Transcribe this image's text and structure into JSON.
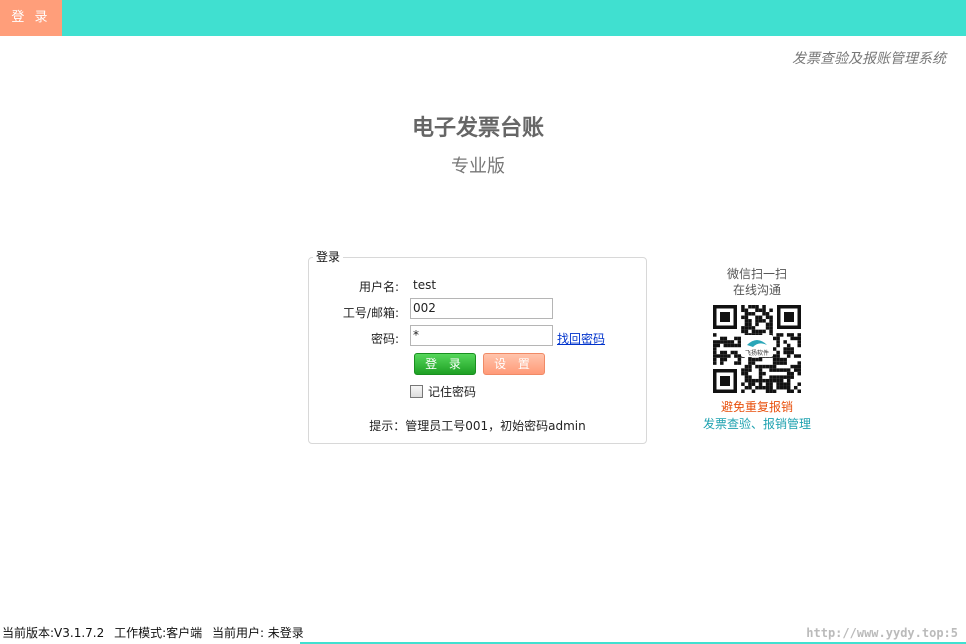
{
  "topbar": {
    "tab_label": "登 录",
    "bar_color": "#40e0d0",
    "tab_color": "#ff9e7a"
  },
  "header": {
    "system_name": "发票查验及报账管理系统",
    "app_title": "电子发票台账",
    "edition": "专业版"
  },
  "login_form": {
    "legend": "登录",
    "username_label": "用户名:",
    "username_value": "test",
    "employee_label": "工号/邮箱:",
    "employee_value": "002",
    "password_label": "密码:",
    "password_value": "*",
    "forgot_link": "找回密码",
    "login_button": "登 录",
    "settings_button": "设 置",
    "remember_label": "记住密码",
    "remember_checked": false,
    "hint": "提示：管理员工号001，初始密码admin"
  },
  "qr": {
    "caption_line1": "微信扫一扫",
    "caption_line2": "在线沟通",
    "brand_text": "飞扬软件",
    "tag1": "避免重复报销",
    "tag2": "发票查验、报销管理",
    "tag1_color": "#e8510e",
    "tag2_color": "#1fa2b0"
  },
  "status_bar": {
    "version": "当前版本:V3.1.7.2",
    "work_mode": "工作模式:客户端",
    "current_user": "当前用户:  未登录",
    "watermark": "http://www.yydy.top:5"
  }
}
